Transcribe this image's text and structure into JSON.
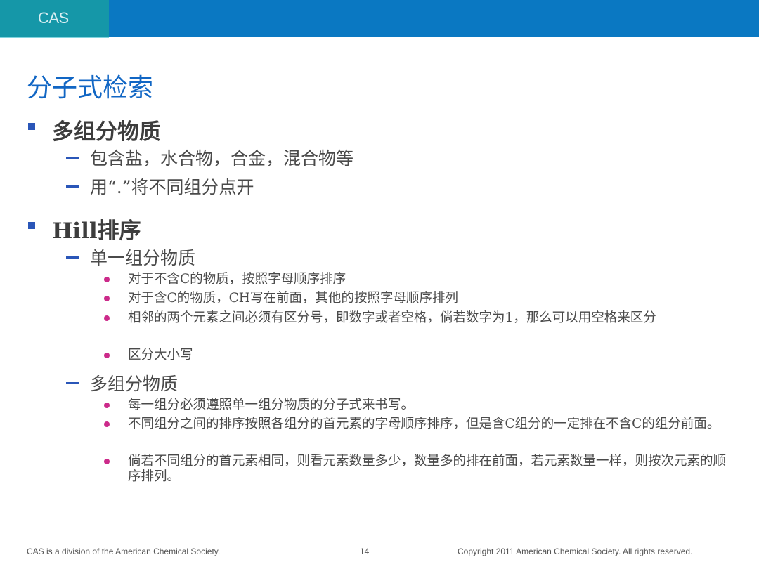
{
  "header": {
    "logo": "CAS",
    "colors": {
      "teal": "#1597a8",
      "blue": "#0a78c2",
      "accent_line": "#7fd3de"
    }
  },
  "slide": {
    "title": "分子式检索",
    "sections": [
      {
        "label": "多组分物质",
        "items": [
          {
            "label": "包含盐，水合物，合金，混合物等"
          },
          {
            "label": "用“.”将不同组分点开"
          }
        ]
      },
      {
        "label": "Hill排序",
        "items": [
          {
            "label": "单一组分物质",
            "bullets": [
              "对于不含C的物质，按照字母顺序排序",
              "对于含C的物质，CH写在前面，其他的按照字母顺序排列",
              "相邻的两个元素之间必须有区分号，即数字或者空格，倘若数字为1，那么可以用空格来区分",
              "区分大小写"
            ]
          },
          {
            "label": "多组分物质",
            "bullets": [
              "每一组分必须遵照单一组分物质的分子式来书写。",
              "不同组分之间的排序按照各组分的首元素的字母顺序排序，但是含C组分的一定排在不含C的组分前面。",
              "倘若不同组分的首元素相同，则看元素数量多少，数量多的排在前面，若元素数量一样，则按次元素的顺序排列。"
            ]
          }
        ]
      }
    ]
  },
  "footer": {
    "left": "CAS is a division of the American Chemical Society.",
    "page_number": "14",
    "right": "Copyright 2011 American Chemical Society. All rights reserved."
  },
  "colors": {
    "title": "#1166c4",
    "square_bullet": "#2a56b8",
    "dash_bullet": "#2a56b8",
    "dot_bullet": "#cc2a8a"
  }
}
